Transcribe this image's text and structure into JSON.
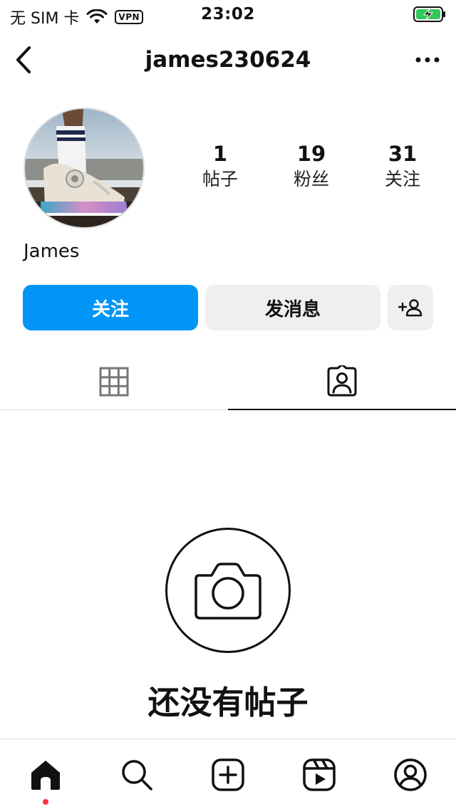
{
  "status_bar": {
    "carrier": "无 SIM 卡",
    "vpn": "VPN",
    "time": "23:02",
    "battery_color": "#34c759"
  },
  "nav": {
    "title": "james230624",
    "back_icon": "chevron-left-icon",
    "more_icon": "ellipsis-icon"
  },
  "profile": {
    "display_name": "James",
    "stats": [
      {
        "value": "1",
        "label": "帖子"
      },
      {
        "value": "19",
        "label": "粉丝"
      },
      {
        "value": "31",
        "label": "关注"
      }
    ]
  },
  "actions": {
    "follow_label": "关注",
    "message_label": "发消息",
    "follow_color": "#0095f6"
  },
  "tabs": {
    "active": "tagged",
    "items": [
      "grid-icon",
      "tagged-icon"
    ]
  },
  "empty_state": {
    "icon": "camera-icon",
    "text": "还没有帖子"
  },
  "bottom_nav": {
    "items": [
      "home-icon",
      "search-icon",
      "create-icon",
      "reels-icon",
      "profile-icon"
    ],
    "notification_dot_color": "#ff3040"
  }
}
